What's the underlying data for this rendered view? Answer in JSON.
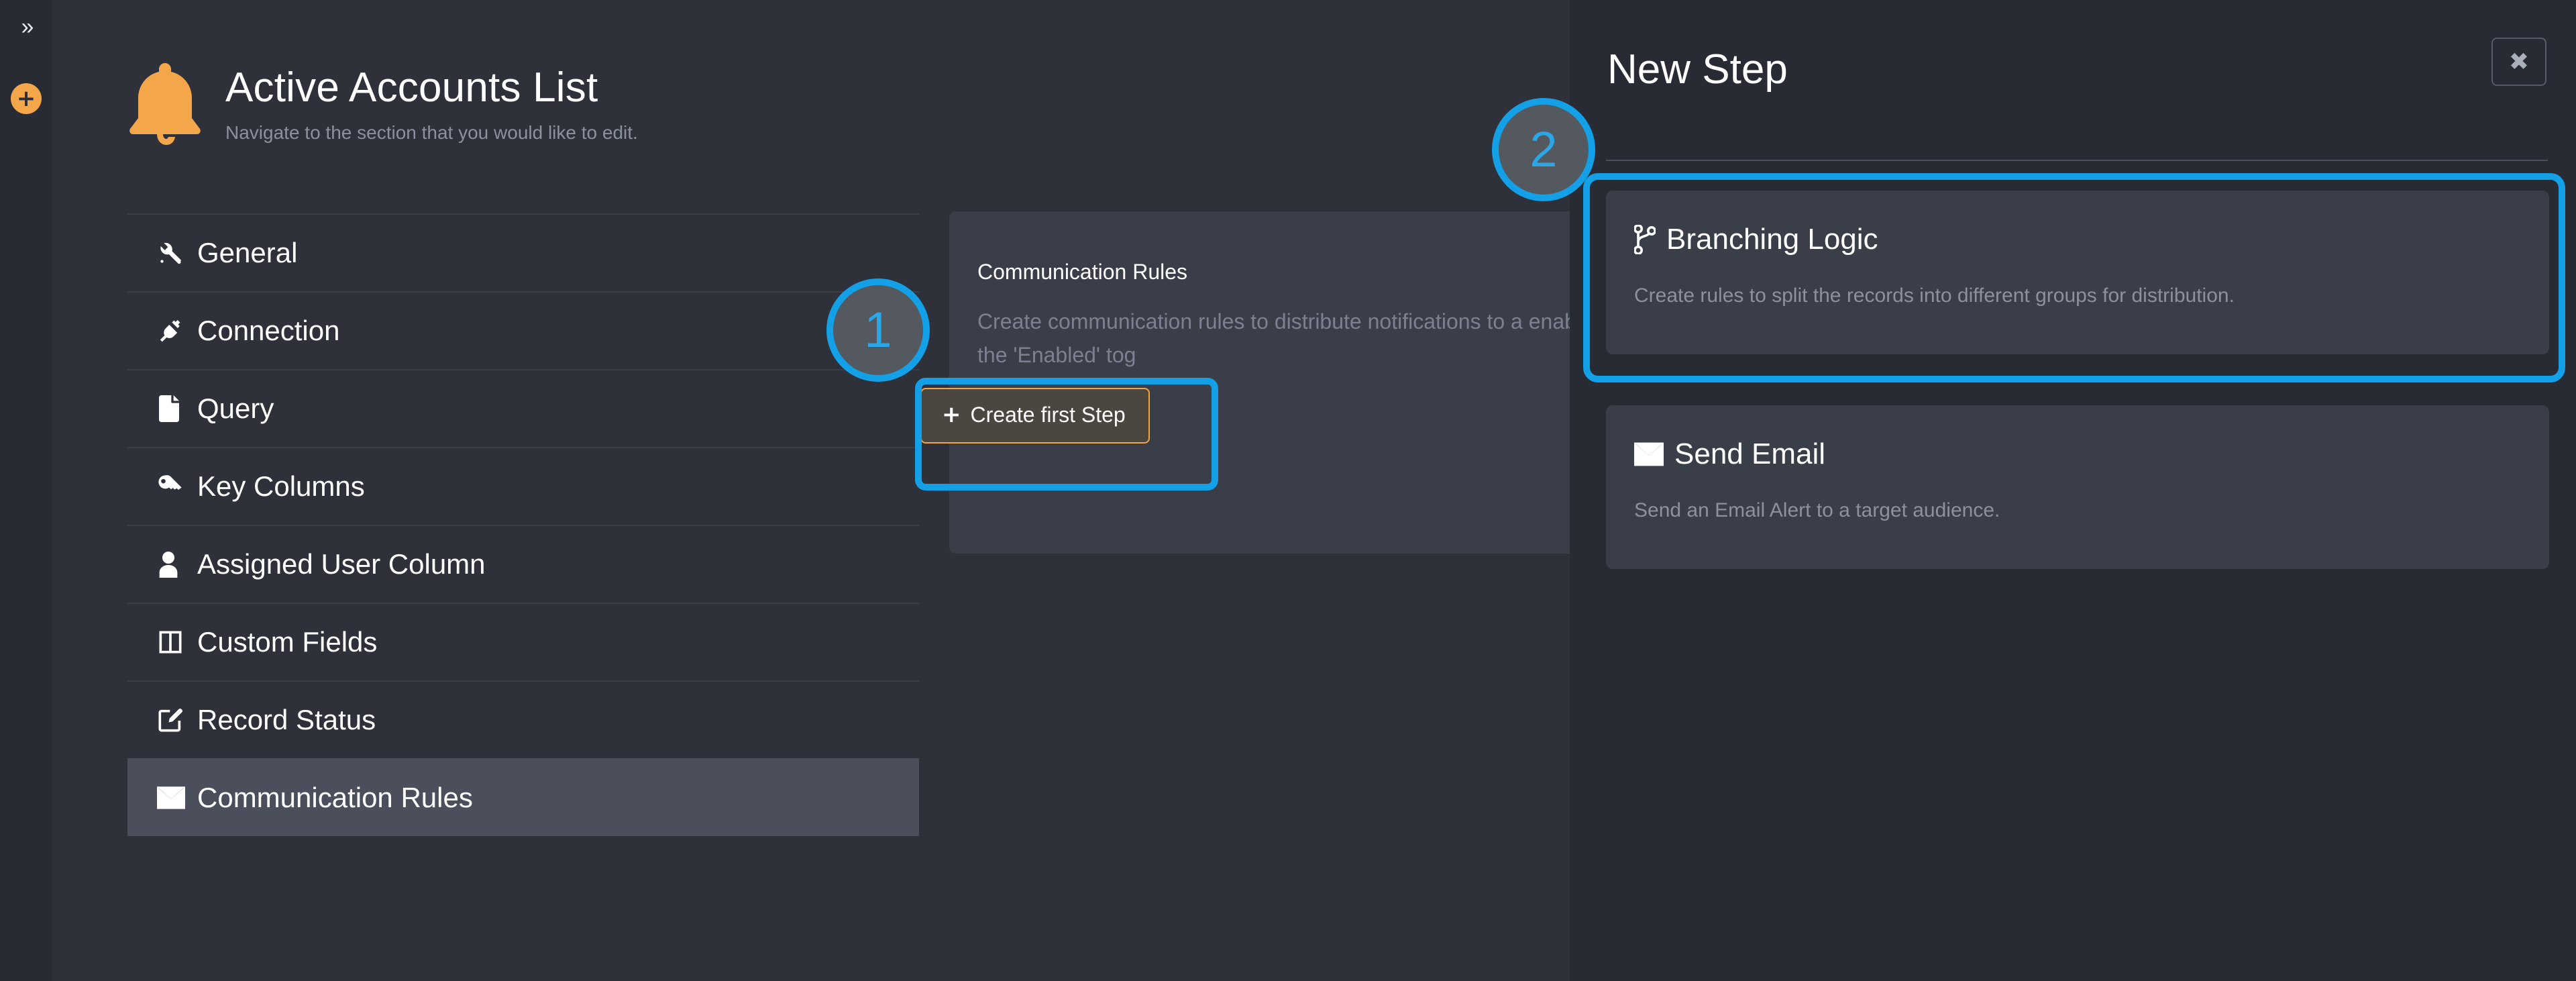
{
  "rail": {
    "collapse_icon": "chevron-double-right-icon",
    "collapse_glyph": "»",
    "add_icon": "plus-circle-icon",
    "add_glyph": "+"
  },
  "page": {
    "icon": "bell-icon",
    "title": "Active Accounts List",
    "subtitle": "Navigate to the section that you would like to edit."
  },
  "sidebar": {
    "items": [
      {
        "label": "General",
        "icon": "wrench-icon",
        "active": false
      },
      {
        "label": "Connection",
        "icon": "plug-icon",
        "active": false
      },
      {
        "label": "Query",
        "icon": "file-icon",
        "active": false
      },
      {
        "label": "Key Columns",
        "icon": "key-icon",
        "active": false
      },
      {
        "label": "Assigned User Column",
        "icon": "user-icon",
        "active": false
      },
      {
        "label": "Custom Fields",
        "icon": "columns-icon",
        "active": false
      },
      {
        "label": "Record Status",
        "icon": "edit-square-icon",
        "active": false
      },
      {
        "label": "Communication Rules",
        "icon": "envelope-icon",
        "active": true
      }
    ]
  },
  "main": {
    "card_title": "Communication Rules",
    "card_description": "Create communication rules to distribute notifications to a enable and disable communications using the 'Enabled' tog",
    "create_button_label": "Create first Step",
    "create_button_icon": "plus-icon",
    "create_button_glyph": "+"
  },
  "right_panel": {
    "title": "New Step",
    "close_icon": "close-icon",
    "close_glyph": "✖",
    "options": [
      {
        "title": "Branching Logic",
        "icon": "code-branch-icon",
        "description": "Create rules to split the records into different groups for distribution.",
        "highlighted": true
      },
      {
        "title": "Send Email",
        "icon": "envelope-icon",
        "description": "Send an Email Alert to a target audience.",
        "highlighted": false
      }
    ]
  },
  "annotations": {
    "badges": [
      {
        "label": "1"
      },
      {
        "label": "2"
      }
    ],
    "accent_color": "#13a0e6"
  },
  "colors": {
    "background": "#2e313a",
    "panel": "#282b33",
    "card": "#3a3e49",
    "accent_orange": "#f4a74a",
    "accent_blue": "#13a0e6",
    "text_primary": "#ffffff",
    "text_muted": "#8b919e"
  }
}
